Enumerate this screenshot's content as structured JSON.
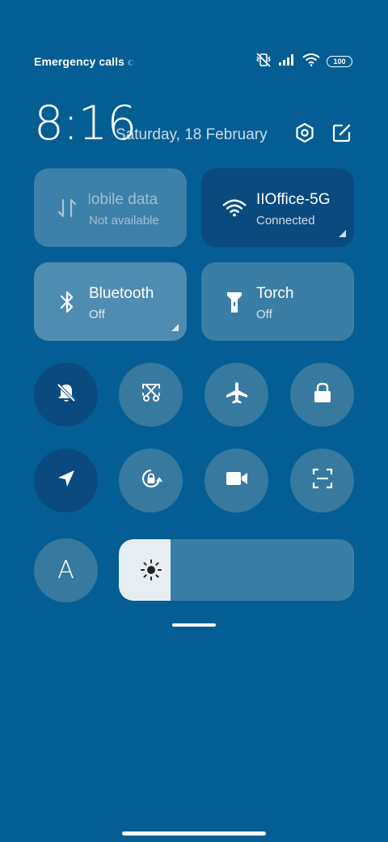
{
  "status_bar": {
    "carrier_text": "Emergency calls only",
    "battery_level": "100",
    "icons": [
      "vibrate-off-icon",
      "signal-icon",
      "wifi-icon",
      "battery-icon"
    ]
  },
  "header": {
    "time": "8:16",
    "date": "Saturday, 18 February",
    "settings_icon": "settings-hexagon-icon",
    "edit_icon": "edit-icon"
  },
  "tiles": [
    {
      "id": "mobile-data",
      "title": "Mobile data",
      "subtitle": "Not available",
      "icon": "data-arrows-icon",
      "state": "disabled"
    },
    {
      "id": "wifi",
      "title": "IIOffice-5G",
      "subtitle": "Connected",
      "icon": "wifi-icon",
      "state": "active"
    },
    {
      "id": "bluetooth",
      "title": "Bluetooth",
      "subtitle": "Off",
      "icon": "bluetooth-icon",
      "state": "off"
    },
    {
      "id": "torch",
      "title": "Torch",
      "subtitle": "Off",
      "icon": "torch-icon",
      "state": "off"
    }
  ],
  "toggles_row1": [
    {
      "id": "mute",
      "icon": "bell-off-icon",
      "active": true
    },
    {
      "id": "screenshot",
      "icon": "scissors-screenshot-icon",
      "active": false
    },
    {
      "id": "airplane",
      "icon": "airplane-icon",
      "active": false
    },
    {
      "id": "lock",
      "icon": "lock-icon",
      "active": false
    }
  ],
  "toggles_row2": [
    {
      "id": "location",
      "icon": "location-arrow-icon",
      "active": true
    },
    {
      "id": "rotation-lock",
      "icon": "rotation-lock-icon",
      "active": false
    },
    {
      "id": "screen-record",
      "icon": "video-camera-icon",
      "active": false
    },
    {
      "id": "scanner",
      "icon": "scan-frame-icon",
      "active": false
    }
  ],
  "auto_brightness": {
    "label": "A",
    "icon": "auto-brightness-icon"
  },
  "brightness": {
    "level_percent": 22,
    "icon": "sun-icon"
  },
  "colors": {
    "background": "#045e94",
    "tile_inactive": "#3a7ea5",
    "tile_active": "#0b4a7e",
    "tile_disabled": "#3d80a9",
    "brightness_fill": "#e6eef3"
  }
}
